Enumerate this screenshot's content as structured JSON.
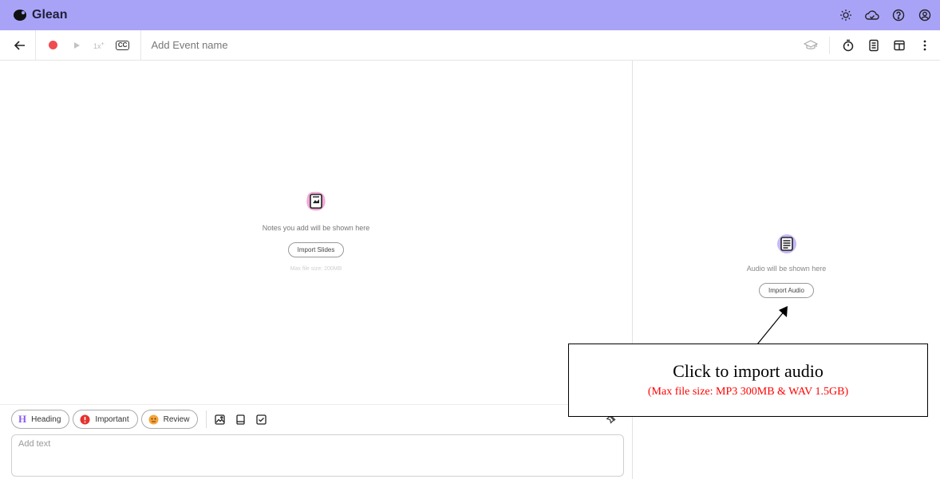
{
  "app": {
    "name": "Glean"
  },
  "toolbar": {
    "speed_label": "1x",
    "speed_superscript": "+",
    "cc_label": "CC",
    "event_name_placeholder": "Add Event name"
  },
  "notes": {
    "empty_text": "Notes you add will be shown here",
    "import_button": "Import Slides",
    "max_size": "Max file size: 200MB"
  },
  "audio": {
    "empty_text": "Audio will be shown here",
    "import_button": "Import Audio"
  },
  "bottom": {
    "chips": [
      {
        "label": "Heading",
        "icon": "heading-icon",
        "glyph": "H"
      },
      {
        "label": "Important",
        "icon": "important-icon"
      },
      {
        "label": "Review",
        "icon": "review-icon"
      }
    ],
    "text_placeholder": "Add text"
  },
  "annotation": {
    "title": "Click to import audio",
    "subtitle": "(Max file size: MP3 300MB & WAV 1.5GB)"
  },
  "colors": {
    "header_bg": "#a9a3f8",
    "record_red": "#f14b52",
    "brand_purple": "#8b5cf6",
    "pink": "#e84fb3"
  }
}
